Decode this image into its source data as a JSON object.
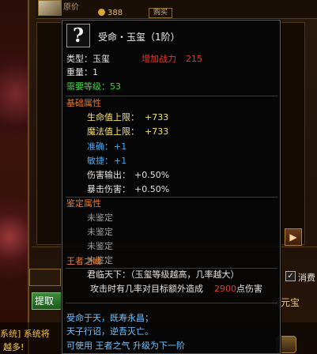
{
  "background": {
    "price_label": "原价",
    "price_value": "388",
    "top_button": "购买",
    "scroll_arrow": "▶",
    "checkbox_label": "消费",
    "checkbox_mark": "✓",
    "extract_button": "提取",
    "right_link": "得元宝",
    "chat_line1": "系统] 系统将",
    "chat_line2": "越多!"
  },
  "tooltip": {
    "icon_glyph": "?",
    "title": "受命・玉玺（1阶）",
    "type_label": "类型：玉玺",
    "power_label": "增加战力",
    "power_value": "215",
    "weight": "重量：1",
    "level_req": "需要等级：53",
    "base_header": "基础属性",
    "base_attrs": [
      {
        "label": "生命值上限：",
        "value": "+733",
        "color": "#f4e36a"
      },
      {
        "label": "魔法值上限：",
        "value": "+733",
        "color": "#f4e36a"
      },
      {
        "label": "准确：",
        "value": "+1",
        "color": "#4aa8f0"
      },
      {
        "label": "敏捷：",
        "value": "+1",
        "color": "#4aa8f0"
      },
      {
        "label": "伤害输出：",
        "value": "+0.50%",
        "color": "#e2e2e2"
      },
      {
        "label": "暴击伤害：",
        "value": "+0.50%",
        "color": "#e2e2e2"
      }
    ],
    "appraise_header": "鉴定属性",
    "appraise_items": [
      "未鉴定",
      "未鉴定",
      "未鉴定",
      "未鉴定"
    ],
    "king_header": "王者之威",
    "king_line1": "君临天下：（玉玺等级越高，几率越大）",
    "king_line2_prefix": "攻击时有几率对目标额外造成",
    "king_line2_value": "2900",
    "king_line2_suffix": "点伤害",
    "poem_line1": "受命于天，既寿永昌；",
    "poem_line2": "天子行诏，逆吾灭亡。",
    "upgrade_line": "可使用 王者之气 升级为下一阶"
  }
}
